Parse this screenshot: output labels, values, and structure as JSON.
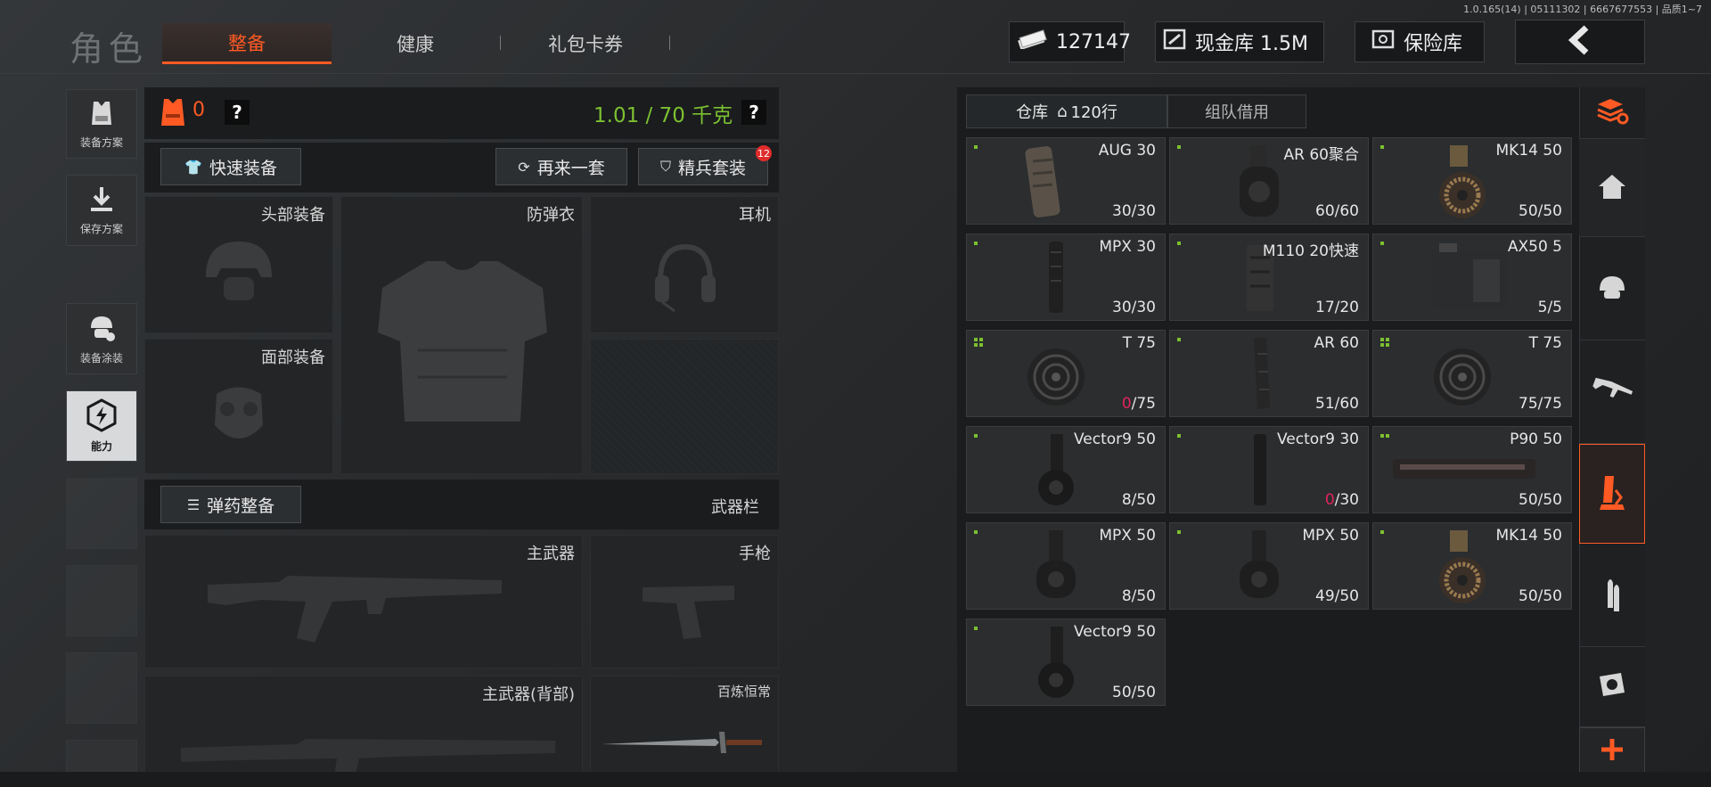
{
  "header": {
    "title": "角色",
    "tabs": [
      {
        "label": "整备",
        "active": true
      },
      {
        "label": "健康",
        "active": false
      },
      {
        "label": "礼包卡券",
        "active": false
      }
    ],
    "version": "1.0.165(14) | 05111302 | 6667677553 | 品质1~7",
    "currency": "127147",
    "cash_vault": "现金库 1.5M",
    "safe": "保险库"
  },
  "rail": [
    {
      "label": "装备方案",
      "icon": "vest-icon"
    },
    {
      "label": "保存方案",
      "icon": "download-icon"
    },
    {
      "label": "装备涂装",
      "icon": "helmet-paint-icon"
    },
    {
      "label": "能力",
      "icon": "ability-icon",
      "active": true
    }
  ],
  "loadout": {
    "armor_count": "0",
    "help": "?",
    "weight": "1.01 / 70 千克",
    "quick_equip": "快速装备",
    "again": "再来一套",
    "elite_set": "精兵套装",
    "elite_badge": "12",
    "slots": {
      "head": "头部装备",
      "vest": "防弹衣",
      "headset": "耳机",
      "face": "面部装备"
    },
    "ammo_btn": "弹药整备",
    "weapons_label": "武器栏",
    "weapon_slots": {
      "primary": "主武器",
      "pistol": "手枪",
      "primary_back": "主武器(背部)",
      "melee": "百炼恒常"
    }
  },
  "storage": {
    "tab_warehouse": "仓库",
    "tab_rows": "120行",
    "tab_team": "组队借用",
    "items": [
      {
        "name": "AUG 30",
        "count": "30/30",
        "empty": false,
        "dots": 1,
        "icon": "aug-mag"
      },
      {
        "name": "AR 60聚合",
        "count": "60/60",
        "empty": false,
        "dots": 1,
        "icon": "ar-drum"
      },
      {
        "name": "MK14 50",
        "count": "50/50",
        "empty": false,
        "dots": 1,
        "icon": "mk14-drum"
      },
      {
        "name": "MPX 30",
        "count": "30/30",
        "empty": false,
        "dots": 1,
        "icon": "mpx-mag"
      },
      {
        "name": "M110 20快速",
        "count": "17/20",
        "empty": false,
        "dots": 1,
        "icon": "m110-mag"
      },
      {
        "name": "AX50 5",
        "count": "5/5",
        "empty": false,
        "dots": 1,
        "icon": "ax50-box"
      },
      {
        "name": "T 75",
        "count_red": "0",
        "count_rest": "/75",
        "empty": true,
        "dots": 4,
        "icon": "t-drum"
      },
      {
        "name": "AR 60",
        "count": "51/60",
        "empty": false,
        "dots": 1,
        "icon": "ar-mag"
      },
      {
        "name": "T 75",
        "count": "75/75",
        "empty": false,
        "dots": 4,
        "icon": "t-drum"
      },
      {
        "name": "Vector9 50",
        "count": "8/50",
        "empty": false,
        "dots": 1,
        "icon": "vector-drum"
      },
      {
        "name": "Vector9 30",
        "count_red": "0",
        "count_rest": "/30",
        "empty": true,
        "dots": 1,
        "icon": "vector-mag"
      },
      {
        "name": "P90 50",
        "count": "50/50",
        "empty": false,
        "dots": 2,
        "icon": "p90-mag"
      },
      {
        "name": "MPX 50",
        "count": "8/50",
        "empty": false,
        "dots": 1,
        "icon": "mpx-drum"
      },
      {
        "name": "MPX 50",
        "count": "49/50",
        "empty": false,
        "dots": 1,
        "icon": "mpx-drum"
      },
      {
        "name": "MK14 50",
        "count": "50/50",
        "empty": false,
        "dots": 1,
        "icon": "mk14-drum"
      },
      {
        "name": "Vector9 50",
        "count": "50/50",
        "empty": false,
        "dots": 1,
        "icon": "vector-drum"
      }
    ]
  },
  "side_tabs": [
    "stack-sort-icon",
    "home-icon",
    "helmet-icon",
    "rifle-icon",
    "ammo-box-icon",
    "bullet-icon",
    "scope-icon",
    "plus-icon"
  ],
  "colors": {
    "accent": "#ff5a24",
    "weight_green": "#7cc030",
    "dot_green": "#7cc030",
    "empty_red": "#e0245b"
  }
}
